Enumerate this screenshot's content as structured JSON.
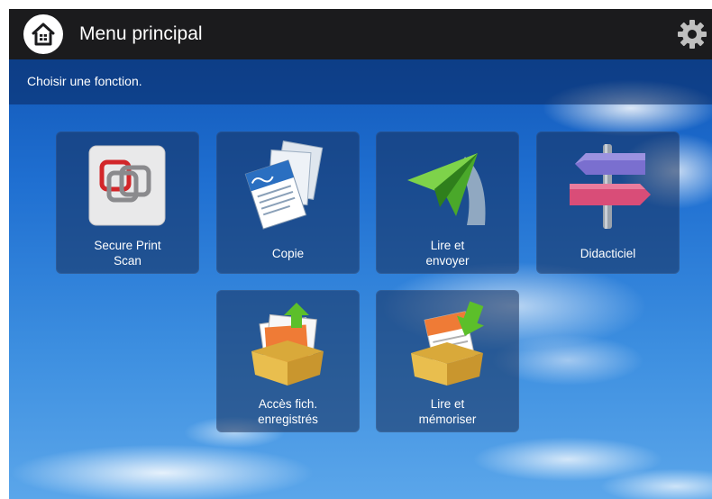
{
  "header": {
    "title": "Menu principal",
    "home_icon": "home-icon",
    "settings_icon": "gear-icon"
  },
  "instruction": "Choisir une fonction.",
  "tiles": [
    {
      "label": "Secure Print\nScan",
      "icon": "secure-print-scan-icon"
    },
    {
      "label": "Copie",
      "icon": "copy-icon"
    },
    {
      "label": "Lire et\nenvoyer",
      "icon": "paper-plane-icon"
    },
    {
      "label": "Didacticiel",
      "icon": "signpost-icon"
    },
    {
      "label": "Accès fich.\nenregistrés",
      "icon": "stored-files-box-icon"
    },
    {
      "label": "Lire et\nmémoriser",
      "icon": "scan-store-box-icon"
    }
  ],
  "colors": {
    "topbar": "#1b1b1d",
    "sky": "#1f6fd1",
    "tile": "rgba(22,45,90,0.55)",
    "arrow_green": "#5cbf2a"
  }
}
